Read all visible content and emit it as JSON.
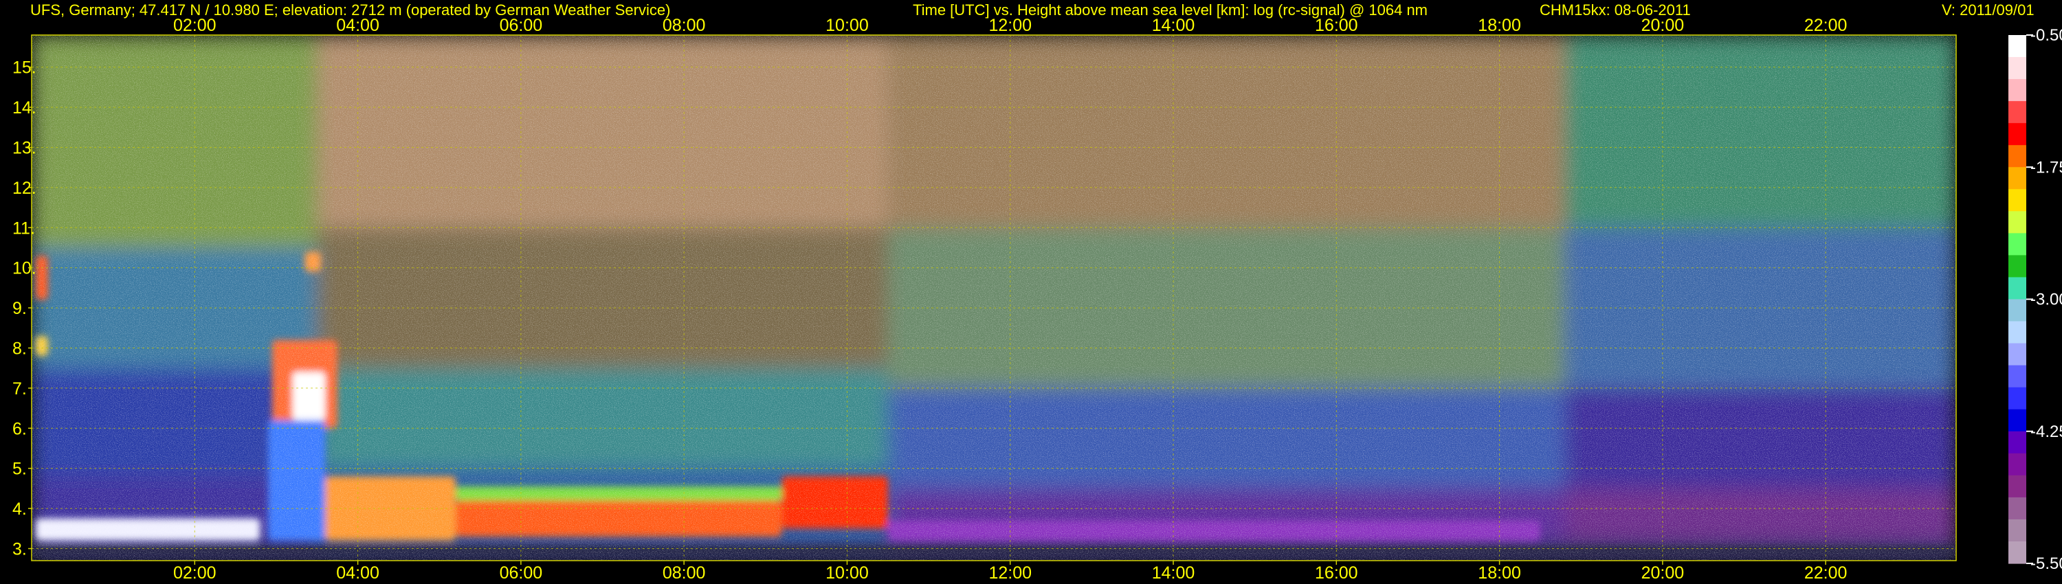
{
  "header": {
    "station": "UFS, Germany; 47.417 N / 10.980 E; elevation: 2712 m  (operated by German Weather Service)",
    "description": "Time [UTC] vs. Height above mean sea level [km]: log (rc-signal) @ 1064 nm",
    "instrument_date": "CHM15kx: 08-06-2011",
    "version": "V: 2011/09/01"
  },
  "colors": {
    "text": "#ffff00",
    "frame": "#d2d200",
    "grid": "#c8c800",
    "colorbar_ticks": "#ffffff",
    "background": "#000000"
  },
  "chart_data": {
    "type": "heatmap",
    "title": "Time [UTC] vs. Height above mean sea level [km]: log (rc-signal) @ 1064 nm",
    "x": {
      "unit": "UTC hour",
      "range": [
        0.0,
        23.6
      ],
      "ticks": [
        2,
        4,
        6,
        8,
        10,
        12,
        14,
        16,
        18,
        20,
        22
      ],
      "tick_labels": [
        "02:00",
        "04:00",
        "06:00",
        "08:00",
        "10:00",
        "12:00",
        "14:00",
        "16:00",
        "18:00",
        "20:00",
        "22:00"
      ]
    },
    "y": {
      "unit": "km",
      "range": [
        2.7,
        15.8
      ],
      "ticks": [
        3,
        4,
        5,
        6,
        7,
        8,
        9,
        10,
        11,
        12,
        13,
        14,
        15
      ],
      "tick_labels": [
        "3.",
        "4.",
        "5.",
        "6.",
        "7.",
        "8.",
        "9.",
        "10.",
        "11.",
        "12.",
        "13.",
        "14.",
        "15."
      ]
    },
    "grid": true,
    "colorbar": {
      "range": [
        -5.5,
        -0.5
      ],
      "ticks": [
        -5.5,
        -4.25,
        -3.0,
        -1.75,
        -0.5
      ],
      "tick_labels": [
        "-5.50",
        "-4.25",
        "-3.00",
        "-1.75",
        "-0.50"
      ],
      "colors": [
        "#ffffff",
        "#ffe0e4",
        "#ffb8c0",
        "#ff4848",
        "#ff0000",
        "#ff7000",
        "#ffb000",
        "#ffe000",
        "#d0ff40",
        "#60ff60",
        "#20c020",
        "#40e0b0",
        "#90c8e0",
        "#b8d8ff",
        "#a0a8ff",
        "#6060ff",
        "#3030ff",
        "#0000e0",
        "#6000c0",
        "#8010a0",
        "#8a2a8a",
        "#986098",
        "#a888a8",
        "#b8a0b8"
      ]
    },
    "signal_map": [
      {
        "x0": 0.0,
        "x1": 3.5,
        "y0": 10.5,
        "y1": 15.8,
        "v": -2.1,
        "c": "#7a9a4a"
      },
      {
        "x0": 0.0,
        "x1": 3.5,
        "y0": 7.5,
        "y1": 10.5,
        "v": -2.6,
        "c": "#3a7aa2"
      },
      {
        "x0": 0.0,
        "x1": 3.5,
        "y0": 4.8,
        "y1": 7.5,
        "v": -3.2,
        "c": "#2a3ca8"
      },
      {
        "x0": 0.0,
        "x1": 3.5,
        "y0": 3.2,
        "y1": 4.8,
        "v": -3.5,
        "c": "#3a2e9c"
      },
      {
        "x0": 3.5,
        "x1": 10.5,
        "y0": 11.0,
        "y1": 15.8,
        "v": -1.2,
        "c": "#b08c6a"
      },
      {
        "x0": 3.5,
        "x1": 10.5,
        "y0": 7.5,
        "y1": 11.0,
        "v": -1.9,
        "c": "#7a6a4c"
      },
      {
        "x0": 3.5,
        "x1": 10.5,
        "y0": 5.0,
        "y1": 7.5,
        "v": -2.6,
        "c": "#3a8a8c"
      },
      {
        "x0": 3.5,
        "x1": 10.5,
        "y0": 3.2,
        "y1": 5.0,
        "v": -3.0,
        "c": "#2a5aa2"
      },
      {
        "x0": 10.5,
        "x1": 18.8,
        "y0": 11.0,
        "y1": 15.8,
        "v": -1.6,
        "c": "#9a7c58"
      },
      {
        "x0": 10.5,
        "x1": 18.8,
        "y0": 7.0,
        "y1": 11.0,
        "v": -2.2,
        "c": "#6a8a6a"
      },
      {
        "x0": 10.5,
        "x1": 18.8,
        "y0": 4.5,
        "y1": 7.0,
        "v": -3.0,
        "c": "#3a5ab2"
      },
      {
        "x0": 10.5,
        "x1": 18.8,
        "y0": 3.2,
        "y1": 4.5,
        "v": -3.8,
        "c": "#5a2a9a"
      },
      {
        "x0": 18.8,
        "x1": 23.6,
        "y0": 11.0,
        "y1": 15.8,
        "v": -2.0,
        "c": "#3e8a6e"
      },
      {
        "x0": 18.8,
        "x1": 23.6,
        "y0": 7.0,
        "y1": 11.0,
        "v": -2.7,
        "c": "#3e68a8"
      },
      {
        "x0": 18.8,
        "x1": 23.6,
        "y0": 4.5,
        "y1": 7.0,
        "v": -3.4,
        "c": "#3a2c9a"
      },
      {
        "x0": 18.8,
        "x1": 23.6,
        "y0": 3.2,
        "y1": 4.5,
        "v": -4.2,
        "c": "#6a2a8a"
      },
      {
        "x0": 0.0,
        "x1": 23.6,
        "y0": 2.7,
        "y1": 3.2,
        "v": -3.6,
        "c": "#2a2a6a"
      }
    ],
    "features": [
      {
        "name": "cloud",
        "x0": 0.05,
        "x1": 0.2,
        "y0": 9.2,
        "y1": 10.3,
        "v": -1.0,
        "c": "#ff5a20"
      },
      {
        "name": "cloud",
        "x0": 0.05,
        "x1": 0.2,
        "y0": 7.8,
        "y1": 8.3,
        "v": -1.2,
        "c": "#ffd040"
      },
      {
        "name": "cloud",
        "x0": 3.35,
        "x1": 3.55,
        "y0": 9.9,
        "y1": 10.4,
        "v": -1.2,
        "c": "#ff9a40"
      },
      {
        "name": "cloud",
        "x0": 2.95,
        "x1": 3.75,
        "y0": 6.0,
        "y1": 8.2,
        "v": -1.0,
        "c": "#ff6a30"
      },
      {
        "name": "cloud-core",
        "x0": 3.2,
        "x1": 3.6,
        "y0": 6.2,
        "y1": 7.4,
        "v": -0.6,
        "c": "#ffffff"
      },
      {
        "name": "precipitation",
        "x0": 2.9,
        "x1": 3.6,
        "y0": 3.2,
        "y1": 6.2,
        "v": -2.8,
        "c": "#3a7aff"
      },
      {
        "name": "boundary-layer",
        "x0": 0.05,
        "x1": 2.8,
        "y0": 3.2,
        "y1": 3.75,
        "v": -0.8,
        "c": "#f0f0ff"
      },
      {
        "name": "boundary-layer",
        "x0": 3.6,
        "x1": 5.2,
        "y0": 3.2,
        "y1": 4.8,
        "v": -1.3,
        "c": "#ff9a30"
      },
      {
        "name": "boundary-layer",
        "x0": 5.2,
        "x1": 9.2,
        "y0": 3.3,
        "y1": 4.2,
        "v": -1.2,
        "c": "#ff5a18"
      },
      {
        "name": "boundary-layer",
        "x0": 5.2,
        "x1": 9.2,
        "y0": 4.2,
        "y1": 4.55,
        "v": -1.7,
        "c": "#80e040"
      },
      {
        "name": "boundary-layer",
        "x0": 9.2,
        "x1": 10.5,
        "y0": 3.5,
        "y1": 4.8,
        "v": -0.9,
        "c": "#ff2a00"
      },
      {
        "name": "aerosol-layer",
        "x0": 10.5,
        "x1": 18.5,
        "y0": 3.2,
        "y1": 3.7,
        "v": -3.3,
        "c": "#8a30c0"
      },
      {
        "name": "surface-return",
        "x0": 0.0,
        "x1": 23.6,
        "y0": 2.85,
        "y1": 3.05,
        "v": -3.0,
        "c": "#202040"
      }
    ]
  }
}
